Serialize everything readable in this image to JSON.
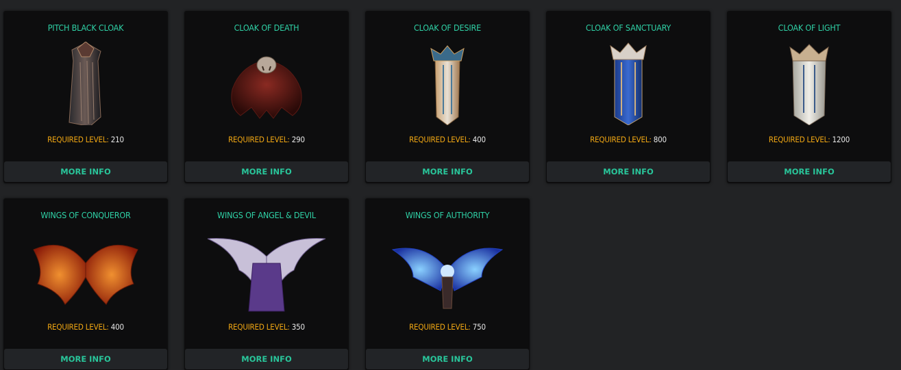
{
  "items": [
    {
      "title": "PITCH BLACK CLOAK",
      "level_label": "REQUIRED LEVEL:",
      "level": "210",
      "button": "MORE INFO",
      "icon": "pitch-black-cloak-image"
    },
    {
      "title": "CLOAK OF DEATH",
      "level_label": "REQUIRED LEVEL:",
      "level": "290",
      "button": "MORE INFO",
      "icon": "cloak-of-death-image"
    },
    {
      "title": "CLOAK OF DESIRE",
      "level_label": "REQUIRED LEVEL:",
      "level": "400",
      "button": "MORE INFO",
      "icon": "cloak-of-desire-image"
    },
    {
      "title": "CLOAK OF SANCTUARY",
      "level_label": "REQUIRED LEVEL:",
      "level": "800",
      "button": "MORE INFO",
      "icon": "cloak-of-sanctuary-image"
    },
    {
      "title": "CLOAK OF LIGHT",
      "level_label": "REQUIRED LEVEL:",
      "level": "1200",
      "button": "MORE INFO",
      "icon": "cloak-of-light-image"
    },
    {
      "title": "WINGS OF CONQUEROR",
      "level_label": "REQUIRED LEVEL:",
      "level": "400",
      "button": "MORE INFO",
      "icon": "wings-of-conqueror-image"
    },
    {
      "title": "WINGS OF ANGEL & DEVIL",
      "level_label": "REQUIRED LEVEL:",
      "level": "350",
      "button": "MORE INFO",
      "icon": "wings-of-angel-devil-image"
    },
    {
      "title": "WINGS OF AUTHORITY",
      "level_label": "REQUIRED LEVEL:",
      "level": "750",
      "button": "MORE INFO",
      "icon": "wings-of-authority-image"
    }
  ],
  "colors": {
    "background": "#222325",
    "card": "#0d0d0e",
    "title": "#2fd1a6",
    "level_label": "#f2a813",
    "button_text": "#29c59a"
  }
}
